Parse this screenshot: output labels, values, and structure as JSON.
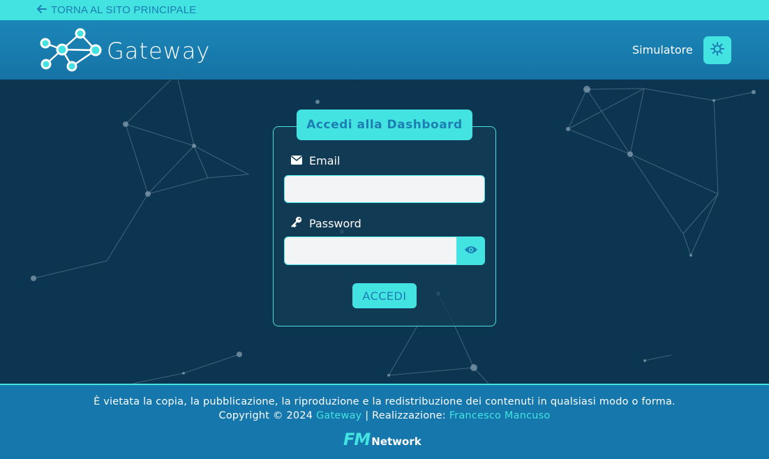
{
  "topbar": {
    "back_label": "TORNA AL SITO PRINCIPALE",
    "back_icon": "arrow-left-icon"
  },
  "navbar": {
    "brand": "Gateway",
    "brand_icon": "network-nodes-logo",
    "simulator_label": "Simulatore",
    "theme_icon": "sun-icon"
  },
  "login": {
    "title": "Accedi alla Dashboard",
    "email_label": "Email",
    "email_icon": "envelope-icon",
    "email_value": "",
    "password_label": "Password",
    "password_icon": "key-icon",
    "password_value": "",
    "toggle_icon": "eye-icon",
    "submit_label": "ACCEDI"
  },
  "footer": {
    "notice": "È vietata la copia, la pubblicazione, la riproduzione e la redistribuzione dei contenuti in qualsiasi modo o forma.",
    "copyright_prefix": "Copyright © 2024",
    "brand_link": "Gateway",
    "separator": "| Realizzazione:",
    "author_link": "Francesco Mancuso",
    "fm_mark": "FM",
    "fm_text": "Network"
  },
  "colors": {
    "accent": "#42e3e0",
    "nav_blue": "#1b86b8",
    "link_blue": "#1c7fb3",
    "background": "#0b3550"
  }
}
